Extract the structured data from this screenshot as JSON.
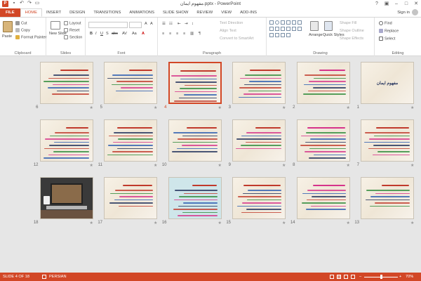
{
  "window": {
    "title": "مفهوم ایمان.pptx - PowerPoint",
    "signin": "Sign in"
  },
  "tabs": [
    "FILE",
    "HOME",
    "INSERT",
    "DESIGN",
    "TRANSITIONS",
    "ANIMATIONS",
    "SLIDE SHOW",
    "REVIEW",
    "VIEW",
    "ADD-INS"
  ],
  "ribbon": {
    "clipboard": {
      "label": "Clipboard",
      "paste": "Paste",
      "cut": "Cut",
      "copy": "Copy",
      "format_painter": "Format Painter"
    },
    "slides": {
      "label": "Slides",
      "new_slide": "New Slide",
      "layout": "Layout",
      "reset": "Reset",
      "section": "Section"
    },
    "font": {
      "label": "Font"
    },
    "paragraph": {
      "label": "Paragraph",
      "text_direction": "Text Direction",
      "align_text": "Align Text",
      "convert": "Convert to SmartArt"
    },
    "drawing": {
      "label": "Drawing",
      "arrange": "Arrange",
      "quick_styles": "Quick Styles",
      "shape_fill": "Shape Fill",
      "shape_outline": "Shape Outline",
      "shape_effects": "Shape Effects"
    },
    "editing": {
      "label": "Editing",
      "find": "Find",
      "replace": "Replace",
      "select": "Select"
    }
  },
  "slides": [
    {
      "num": "1",
      "title": "مفهوم ایمان",
      "selected": false
    },
    {
      "num": "2",
      "selected": false
    },
    {
      "num": "3",
      "selected": false
    },
    {
      "num": "4",
      "selected": true
    },
    {
      "num": "5",
      "selected": false
    },
    {
      "num": "6",
      "selected": false
    },
    {
      "num": "7",
      "selected": false
    },
    {
      "num": "8",
      "selected": false
    },
    {
      "num": "9",
      "selected": false
    },
    {
      "num": "10",
      "selected": false
    },
    {
      "num": "11",
      "selected": false
    },
    {
      "num": "12",
      "selected": false
    },
    {
      "num": "13",
      "selected": false
    },
    {
      "num": "14",
      "selected": false
    },
    {
      "num": "15",
      "selected": false
    },
    {
      "num": "16",
      "selected": false
    },
    {
      "num": "17",
      "selected": false
    },
    {
      "num": "18",
      "selected": false
    }
  ],
  "status": {
    "slide_of": "SLIDE 4 OF 18",
    "language": "PERSIAN",
    "zoom": "70%"
  },
  "colors": {
    "accent": "#d24726",
    "title_red": "#c0392b",
    "text_dark": "#1f2f5a",
    "green": "#2e8b3a",
    "pink": "#d6338a",
    "blue": "#2a5db0"
  }
}
